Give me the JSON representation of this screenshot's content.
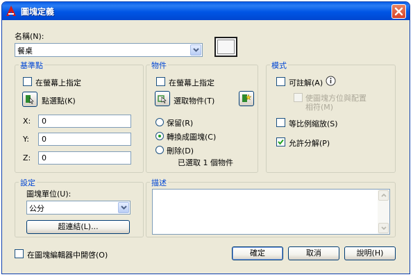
{
  "window": {
    "title": "圖塊定義"
  },
  "name": {
    "label": "名稱(N):",
    "value": "餐桌"
  },
  "base_point": {
    "group_title": "基準點",
    "specify_on_screen": "在螢幕上指定",
    "pick_point": "點選點(K)",
    "x_label": "X:",
    "x_value": "0",
    "y_label": "Y:",
    "y_value": "0",
    "z_label": "Z:",
    "z_value": "0"
  },
  "objects": {
    "group_title": "物件",
    "specify_on_screen": "在螢幕上指定",
    "select_objects": "選取物件(T)",
    "retain": "保留(R)",
    "convert_to_block": "轉換成圖塊(C)",
    "delete": "刪除(D)",
    "status": "已選取 1 個物件"
  },
  "behavior": {
    "group_title": "模式",
    "annotative": "可註解(A)",
    "info_icon": "info-icon",
    "match_orientation_line1": "使圖塊方位與配置",
    "match_orientation_line2": "相符(M)",
    "scale_uniformly": "等比例縮放(S)",
    "allow_exploding": "允許分解(P)"
  },
  "settings": {
    "group_title": "設定",
    "block_unit_label": "圖塊單位(U):",
    "block_unit_value": "公分",
    "hyperlink": "超連結(L)..."
  },
  "description": {
    "group_title": "描述",
    "value": ""
  },
  "open_in_editor": "在圖塊編輯器中開啓(O)",
  "buttons": {
    "ok": "確定",
    "cancel": "取消",
    "help": "說明(H)"
  },
  "colors": {
    "titlebar": "#0055e5",
    "group_title": "#0046d5",
    "check_green": "#21a121"
  }
}
